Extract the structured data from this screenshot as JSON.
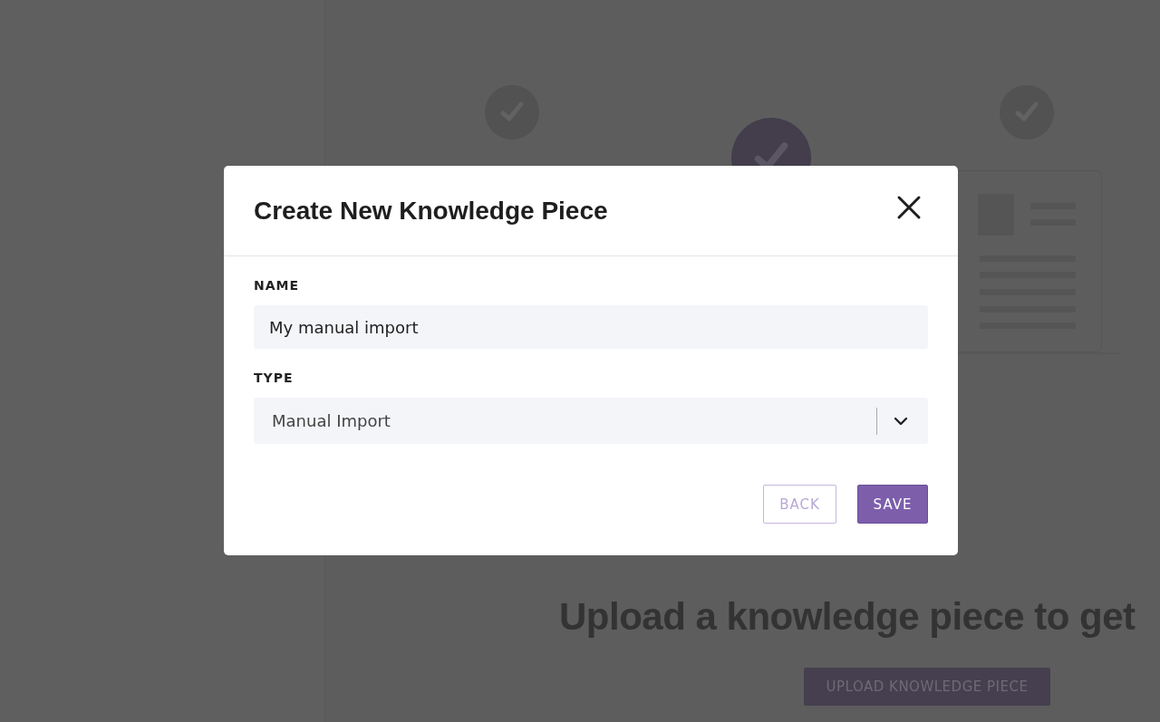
{
  "background": {
    "steps": [
      {
        "selected": false
      },
      {
        "selected": true
      },
      {
        "selected": false
      }
    ],
    "heading": "Upload a knowledge piece to get",
    "upload_button": "UPLOAD KNOWLEDGE PIECE"
  },
  "dialog": {
    "title": "Create New Knowledge Piece",
    "fields": [
      {
        "label": "NAME",
        "kind": "text",
        "value": "My manual import"
      },
      {
        "label": "TYPE",
        "kind": "select",
        "value": "Manual Import"
      }
    ],
    "buttons": [
      {
        "label": "BACK",
        "kind": "secondary"
      },
      {
        "label": "SAVE",
        "kind": "primary"
      }
    ]
  }
}
